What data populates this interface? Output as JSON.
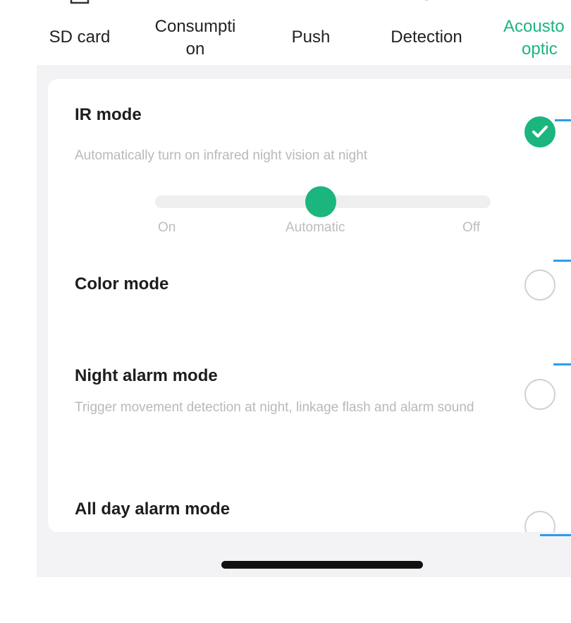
{
  "tabs": [
    {
      "label_line1": "SD card",
      "label_line2": "",
      "icon": "sd-card-icon"
    },
    {
      "label_line1": "Consumpti",
      "label_line2": "on",
      "icon": "battery-icon"
    },
    {
      "label_line1": "Push",
      "label_line2": "",
      "icon": "message-icon"
    },
    {
      "label_line1": "Detection",
      "label_line2": "",
      "icon": "target-icon"
    },
    {
      "label_line1": "Acousto",
      "label_line2": "optic",
      "icon": "alarm-light-icon",
      "active": true
    }
  ],
  "options": [
    {
      "title": "IR mode",
      "description": "Automatically turn on infrared night vision at night",
      "selected": true
    },
    {
      "title": "Color mode",
      "description": "",
      "selected": false
    },
    {
      "title": "Night alarm mode",
      "description": "Trigger movement detection at night, linkage flash and alarm sound",
      "selected": false
    },
    {
      "title": "All day alarm mode",
      "description": "",
      "selected": false
    }
  ],
  "ir_slider": {
    "labels": [
      "On",
      "Automatic",
      "Off"
    ],
    "selected": "Automatic",
    "value_fraction": 0.5
  },
  "colors": {
    "accent": "#1bb57e",
    "line_blue": "#2f9bea",
    "secondary_text": "#b9b9b9"
  }
}
